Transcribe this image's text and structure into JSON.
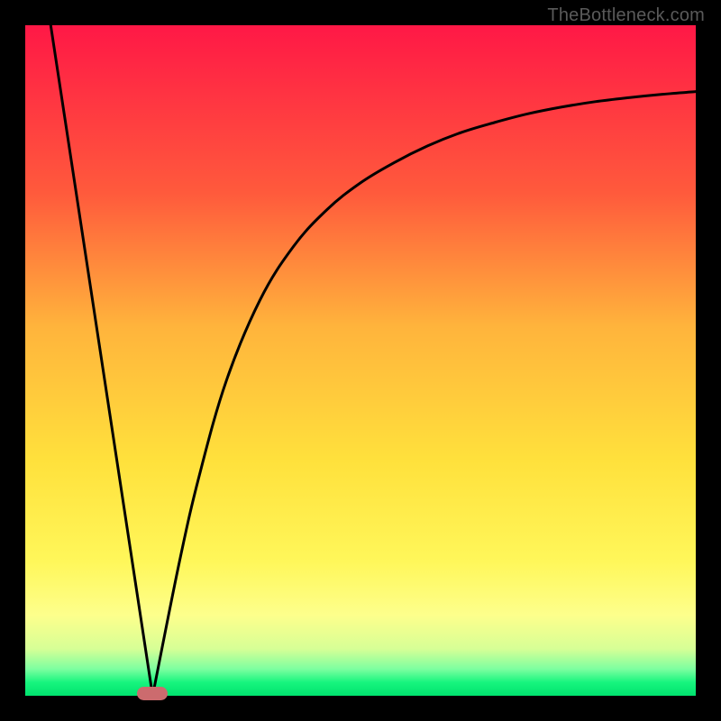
{
  "watermark_text": "TheBottleneck.com",
  "colors": {
    "frame": "#000000",
    "gradient_top": "#ff1846",
    "gradient_bottom": "#00e26e",
    "curve_stroke": "#000000",
    "marker_fill": "#cc6b6e"
  },
  "chart_data": {
    "type": "line",
    "title": "",
    "xlabel": "",
    "ylabel": "",
    "xlim": [
      0,
      100
    ],
    "ylim": [
      0,
      100
    ],
    "note": "Bottleneck-style V curve. Minimum near x≈19 reaches y≈0. Right branch rises asymptotically approaching ~90 at x=100. No tick labels are shown on either axis.",
    "series": [
      {
        "name": "left_branch",
        "x": [
          3.8,
          19
        ],
        "y": [
          100,
          0
        ]
      },
      {
        "name": "right_branch",
        "x": [
          19,
          23,
          26,
          30,
          35,
          40,
          45,
          50,
          55,
          60,
          65,
          70,
          75,
          80,
          85,
          90,
          95,
          100
        ],
        "y": [
          0,
          20,
          33,
          47,
          59,
          67,
          72.5,
          76.5,
          79.5,
          82,
          84,
          85.5,
          86.8,
          87.8,
          88.6,
          89.2,
          89.7,
          90.1
        ]
      }
    ],
    "marker": {
      "x": 19,
      "y": 0,
      "shape": "pill"
    }
  }
}
